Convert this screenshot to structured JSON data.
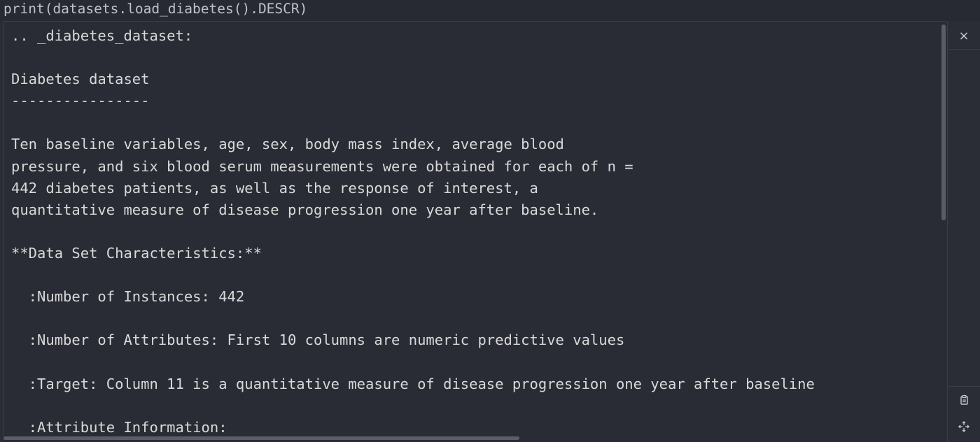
{
  "input": {
    "code": "print(datasets.load_diabetes().DESCR)"
  },
  "output": {
    "text": ".. _diabetes_dataset:\n\nDiabetes dataset\n----------------\n\nTen baseline variables, age, sex, body mass index, average blood\npressure, and six blood serum measurements were obtained for each of n =\n442 diabetes patients, as well as the response of interest, a\nquantitative measure of disease progression one year after baseline.\n\n**Data Set Characteristics:**\n\n  :Number of Instances: 442\n\n  :Number of Attributes: First 10 columns are numeric predictive values\n\n  :Target: Column 11 is a quantitative measure of disease progression one year after baseline\n\n  :Attribute Information:"
  },
  "toolbar": {
    "close_label": "×",
    "copy_icon": "copy-icon",
    "expand_icon": "expand-icon"
  }
}
